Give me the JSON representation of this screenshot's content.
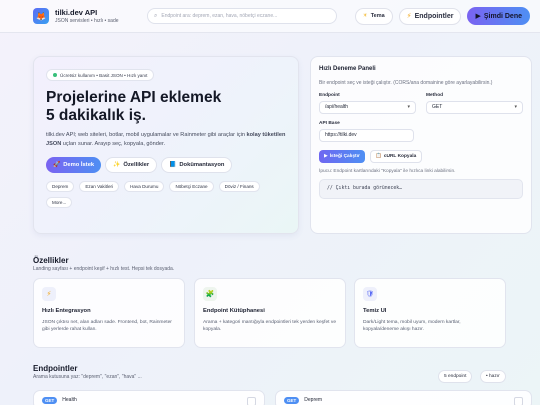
{
  "header": {
    "app_title": "tilki.dev API",
    "app_subtitle": "JSON servisleri • hızlı • sade",
    "search_placeholder": "Endpoint ara: deprem, ezan, hava, nöbetçi eczane...",
    "theme_label": "Tema",
    "endpoints_label": "Endpointler",
    "try_now_label": "Şimdi Dene"
  },
  "hero": {
    "badge": "Ücretsiz kullanım • Basit JSON • Hızlı yanıt",
    "title_line1": "Projelerine API eklemek",
    "title_line2": "5 dakikalık iş.",
    "desc_part1": "tilki.dev API; web siteleri, botlar, mobil uygulamalar ve Rainmeter gibi araçlar için ",
    "desc_bold": "kolay tüketilen JSON",
    "desc_part2": " uçları sunar. Arayıp seç, kopyala, gönder.",
    "buttons": {
      "demo": "Demo İstek",
      "features": "Özellikler",
      "docs": "Dokümantasyon"
    },
    "chips": [
      "Deprem",
      "Ezan Vakitleri",
      "Hava Durumu",
      "Nöbetçi Eczane",
      "Döviz / Finans",
      "More..."
    ]
  },
  "panel": {
    "title": "Hızlı Deneme Paneli",
    "desc": "Bir endpoint seç ve isteği çalıştır. (CORS/ana domainine göre ayarlayabilirsin.)",
    "endpoint_label": "Endpoint",
    "endpoint_value": "/api/health",
    "method_label": "Method",
    "method_value": "GET",
    "api_base_label": "API Base",
    "api_base_value": "https://tilki.dev",
    "run_label": "İsteği Çalıştır",
    "curl_label": "cURL Kopyala",
    "hint": "İpucu: Endpoint kartlarındaki \"Kopyala\" ile hızlıca linki alabilirsin.",
    "output": "// Çıktı burada görünecek…"
  },
  "features": {
    "title": "Özellikler",
    "subtitle": "Landing sayfası + endpoint keşif + hızlı test. Hepsi tek dosyada.",
    "items": [
      {
        "icon": "lightning",
        "title": "Hızlı Entegrasyon",
        "desc": "JSON çıktısı net, alan adları sade. Frontend, bot, Rainmeter gibi yerlerde rahat kullan."
      },
      {
        "icon": "puzzle",
        "title": "Endpoint Kütüphanesi",
        "desc": "Arama + kategori mantığıyla endpointleri tek yerden keşfet ve kopyala."
      },
      {
        "icon": "shield",
        "title": "Temiz UI",
        "desc": "Dark/Light tema, mobil uyum, modern kartlar, kopyala/deneme akışı hazır."
      }
    ]
  },
  "endpoints": {
    "title": "Endpointler",
    "subtitle": "Arama kutusuna yaz: \"deprem\", \"ezan\", \"hava\" ...",
    "count_label": "5 endpoint",
    "quick_label": "• hazır",
    "cards": [
      {
        "method": "GET",
        "name": "Health"
      },
      {
        "method": "GET",
        "name": "Deprem"
      }
    ]
  },
  "colors": {
    "accent_start": "#7a63f1",
    "accent_end": "#4e8ff3",
    "status_green": "#38c07a"
  }
}
